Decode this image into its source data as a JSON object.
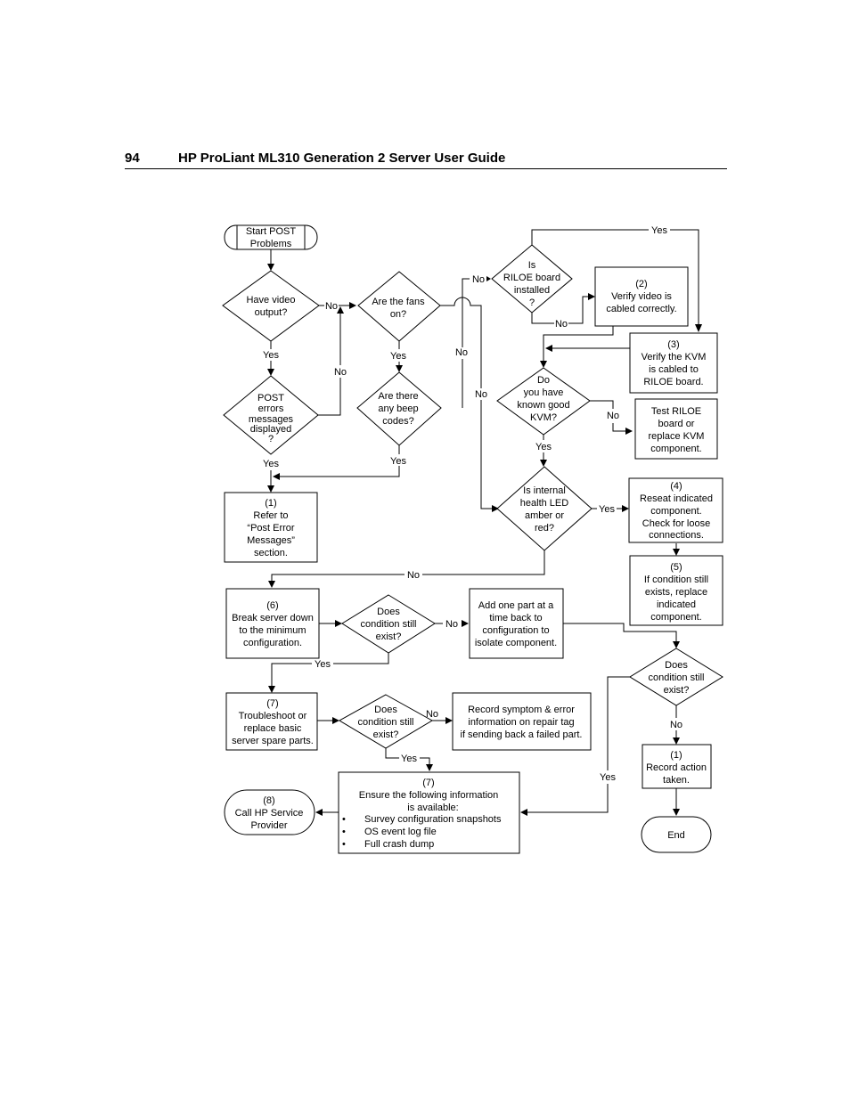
{
  "header": {
    "page_number": "94",
    "title": "HP ProLiant ML310 Generation 2 Server User Guide"
  },
  "flowchart": {
    "nodes": {
      "start": [
        "Start POST",
        "Problems"
      ],
      "have_video": [
        "Have video",
        "output?"
      ],
      "post_errors": [
        "POST",
        "errors",
        "messages",
        "displayed",
        "?"
      ],
      "fans_on": [
        "Are the fans",
        "on?"
      ],
      "beep_codes": [
        "Are there",
        "any beep",
        "codes?"
      ],
      "riloe_installed": [
        "Is",
        "RILOE board",
        "installed",
        "?"
      ],
      "verify_video": [
        "(2)",
        "Verify video is",
        "cabled correctly."
      ],
      "verify_kvm": [
        "(3)",
        "Verify the KVM",
        "is cabled to",
        "RILOE board."
      ],
      "known_good_kvm": [
        "Do",
        "you have",
        "known good",
        "KVM?"
      ],
      "test_riloe": [
        "Test RILOE",
        "board or",
        "replace KVM",
        "component."
      ],
      "refer_post": [
        "(1)",
        "Refer to",
        "“Post Error",
        "Messages”",
        "section."
      ],
      "health_led": [
        "Is internal",
        "health LED",
        "amber or",
        "red?"
      ],
      "reseat": [
        "(4)",
        "Reseat indicated",
        "component.",
        "Check for loose",
        "connections."
      ],
      "replace_component": [
        "(5)",
        "If condition still",
        "exists, replace",
        "indicated",
        "component."
      ],
      "break_down": [
        "(6)",
        "Break server down",
        "to the minimum",
        "configuration."
      ],
      "condition_exist_1": [
        "Does",
        "condition still",
        "exist?"
      ],
      "add_part": [
        "Add one part at a",
        "time back to",
        "configuration to",
        "isolate component."
      ],
      "condition_exist_2": [
        "Does",
        "condition still",
        "exist?"
      ],
      "troubleshoot": [
        "(7)",
        "Troubleshoot or",
        "replace basic",
        "server spare parts."
      ],
      "condition_exist_3": [
        "Does",
        "condition still",
        "exist?"
      ],
      "record_symptom": [
        "Record symptom & error",
        "information on repair tag",
        "if sending back a failed part."
      ],
      "record_action": [
        "(1)",
        "Record action",
        "taken."
      ],
      "ensure_info": [
        "(7)",
        "Ensure the following information",
        "is available:"
      ],
      "ensure_bullets": [
        "Survey configuration snapshots",
        "OS event log file",
        "Full crash dump"
      ],
      "call_hp": [
        "(8)",
        "Call HP Service",
        "Provider"
      ],
      "end": [
        "End"
      ]
    },
    "labels": {
      "yes": "Yes",
      "no": "No",
      "bullet": "•"
    }
  }
}
